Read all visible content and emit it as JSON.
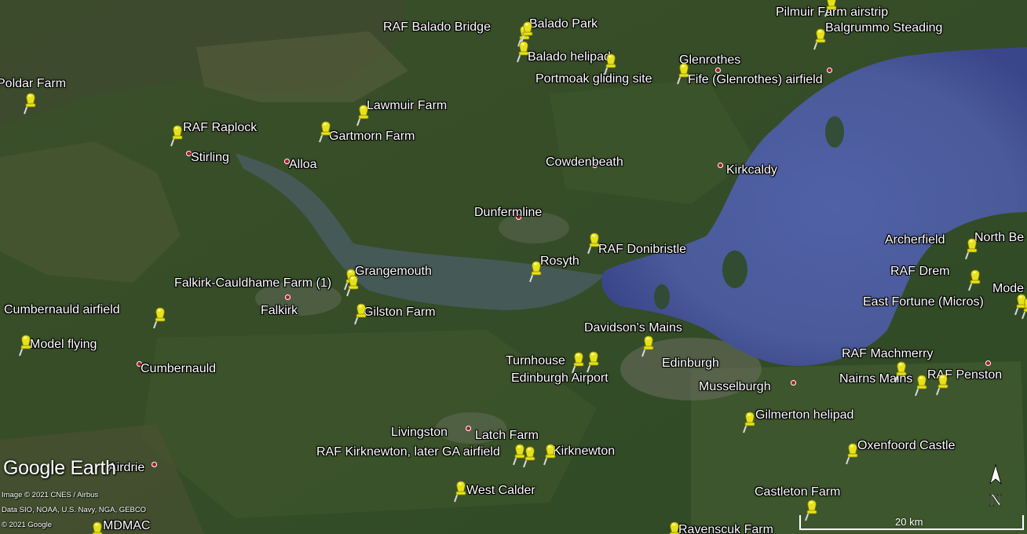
{
  "map": {
    "colors": {
      "land": "#2f4a26",
      "water": "#4a5a9a",
      "water_deep": "#3a468a",
      "estuary": "#475a58",
      "town_marker": "#b0182a",
      "pin": "#e6e21a"
    },
    "icons": {
      "placemark": "yellow-pushpin-icon",
      "town": "red-dot-icon",
      "north": "north-arrow-icon"
    }
  },
  "places": [
    {
      "name": "Stirling"
    },
    {
      "name": "Alloa"
    },
    {
      "name": "Cowdenbeath"
    },
    {
      "name": "Kirkcaldy"
    },
    {
      "name": "Dunfermline"
    },
    {
      "name": "Glenrothes"
    },
    {
      "name": "Falkirk"
    },
    {
      "name": "Cumbernauld"
    },
    {
      "name": "Edinburgh"
    },
    {
      "name": "Musselburgh"
    },
    {
      "name": "Livingston"
    },
    {
      "name": "Airdrie"
    }
  ],
  "placemarks": [
    {
      "name": "Pilmuir Farm airstrip"
    },
    {
      "name": "RAF Balado Bridge"
    },
    {
      "name": "Balado Park"
    },
    {
      "name": "Balgrummo Steading"
    },
    {
      "name": "Balado helipad"
    },
    {
      "name": "Portmoak gliding site"
    },
    {
      "name": "Fife (Glenrothes) airfield"
    },
    {
      "name": "Poldar Farm"
    },
    {
      "name": "Lawmuir Farm"
    },
    {
      "name": "RAF Raplock"
    },
    {
      "name": "Gartmorn Farm"
    },
    {
      "name": "RAF Donibristle"
    },
    {
      "name": "Rosyth"
    },
    {
      "name": "Grangemouth"
    },
    {
      "name": "Falkirk-Cauldhame Farm (1)"
    },
    {
      "name": "Gilston Farm"
    },
    {
      "name": "Cumbernauld airfield"
    },
    {
      "name": "Model flying"
    },
    {
      "name": "Davidson's Mains"
    },
    {
      "name": "Turnhouse"
    },
    {
      "name": "Edinburgh Airport"
    },
    {
      "name": "Archerfield"
    },
    {
      "name": "North Be"
    },
    {
      "name": "RAF Drem"
    },
    {
      "name": "Mode"
    },
    {
      "name": "East Fortune (Micros)"
    },
    {
      "name": "RAF Machmerry"
    },
    {
      "name": "Nairns Mains"
    },
    {
      "name": "RAF Penston"
    },
    {
      "name": "Gilmerton helipad"
    },
    {
      "name": "Latch Farm"
    },
    {
      "name": "RAF Kirknewton, later GA airfield"
    },
    {
      "name": "Kirknewton"
    },
    {
      "name": "Oxenfoord Castle"
    },
    {
      "name": "West Calder"
    },
    {
      "name": "Castleton Farm"
    },
    {
      "name": "MDMAC"
    },
    {
      "name": "Ravenscuk Farm"
    }
  ],
  "overlay": {
    "logo": "Google Earth",
    "credit_1": "Image © 2021 CNES / Airbus",
    "credit_2": "Data SIO, NOAA, U.S. Navy, NGA, GEBCO",
    "credit_3": "© 2021 Google",
    "north_label": "N",
    "scale_label": "20 km"
  }
}
